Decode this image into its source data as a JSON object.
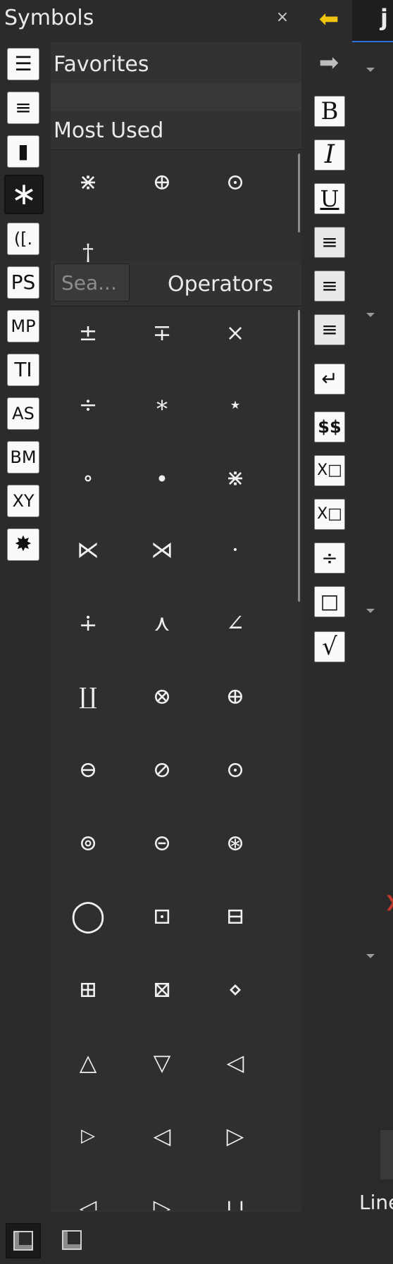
{
  "panel": {
    "title": "Symbols",
    "close_icon": "×"
  },
  "categories": [
    {
      "name": "list-icon",
      "glyph": "☰"
    },
    {
      "name": "text-lines-icon",
      "glyph": "≡"
    },
    {
      "name": "bookmark-icon",
      "glyph": "▮"
    },
    {
      "name": "asterisk-icon",
      "glyph": "∗"
    },
    {
      "name": "brackets-icon",
      "glyph": "([."
    },
    {
      "name": "ps-icon",
      "glyph": "PS"
    },
    {
      "name": "mp-icon",
      "glyph": "MP"
    },
    {
      "name": "ti-icon",
      "glyph": "TI"
    },
    {
      "name": "as-icon",
      "glyph": "AS"
    },
    {
      "name": "bm-icon",
      "glyph": "BM"
    },
    {
      "name": "xy-icon",
      "glyph": "XY"
    },
    {
      "name": "splat-icon",
      "glyph": "✸"
    }
  ],
  "favorites": {
    "title": "Favorites"
  },
  "most_used": {
    "title": "Most Used",
    "symbols": [
      "⋇",
      "⊕",
      "⊙",
      "†"
    ]
  },
  "search": {
    "placeholder": "Sea..."
  },
  "operators": {
    "title": "Operators",
    "symbols": [
      "±",
      "∓",
      "×",
      "÷",
      "∗",
      "⋆",
      "∘",
      "∙",
      "⋇",
      "⋉",
      "⋊",
      "·",
      "∔",
      "⋏",
      "∠",
      "∐",
      "⊗",
      "⊕",
      "⊖",
      "⊘",
      "⊙",
      "⊚",
      "⊝",
      "⊛",
      "◯",
      "⊡",
      "⊟",
      "⊞",
      "⊠",
      "⋄",
      "△",
      "▽",
      "◁",
      "▷",
      "◁",
      "▷",
      "◁",
      "▷",
      "⊔"
    ]
  },
  "toolbar": [
    {
      "name": "back-arrow-icon",
      "glyph": "⬅"
    },
    {
      "name": "forward-arrow-icon",
      "glyph": "➡"
    },
    {
      "name": "bold-button",
      "glyph": "B"
    },
    {
      "name": "italic-button",
      "glyph": "I"
    },
    {
      "name": "underline-button",
      "glyph": "U"
    },
    {
      "name": "align-left-button",
      "glyph": "≡"
    },
    {
      "name": "align-center-button",
      "glyph": "≡"
    },
    {
      "name": "align-right-button",
      "glyph": "≡"
    },
    {
      "name": "newline-button",
      "glyph": "↵"
    },
    {
      "name": "display-math-button",
      "glyph": "$$"
    },
    {
      "name": "subscript-button",
      "glyph": "X□"
    },
    {
      "name": "superscript-button",
      "glyph": "X□"
    },
    {
      "name": "inline-fraction-button",
      "glyph": "÷"
    },
    {
      "name": "fraction-button",
      "glyph": "□"
    },
    {
      "name": "sqrt-button",
      "glyph": "√"
    }
  ],
  "editor": {
    "tab_label": "j",
    "line_label": "Line"
  }
}
